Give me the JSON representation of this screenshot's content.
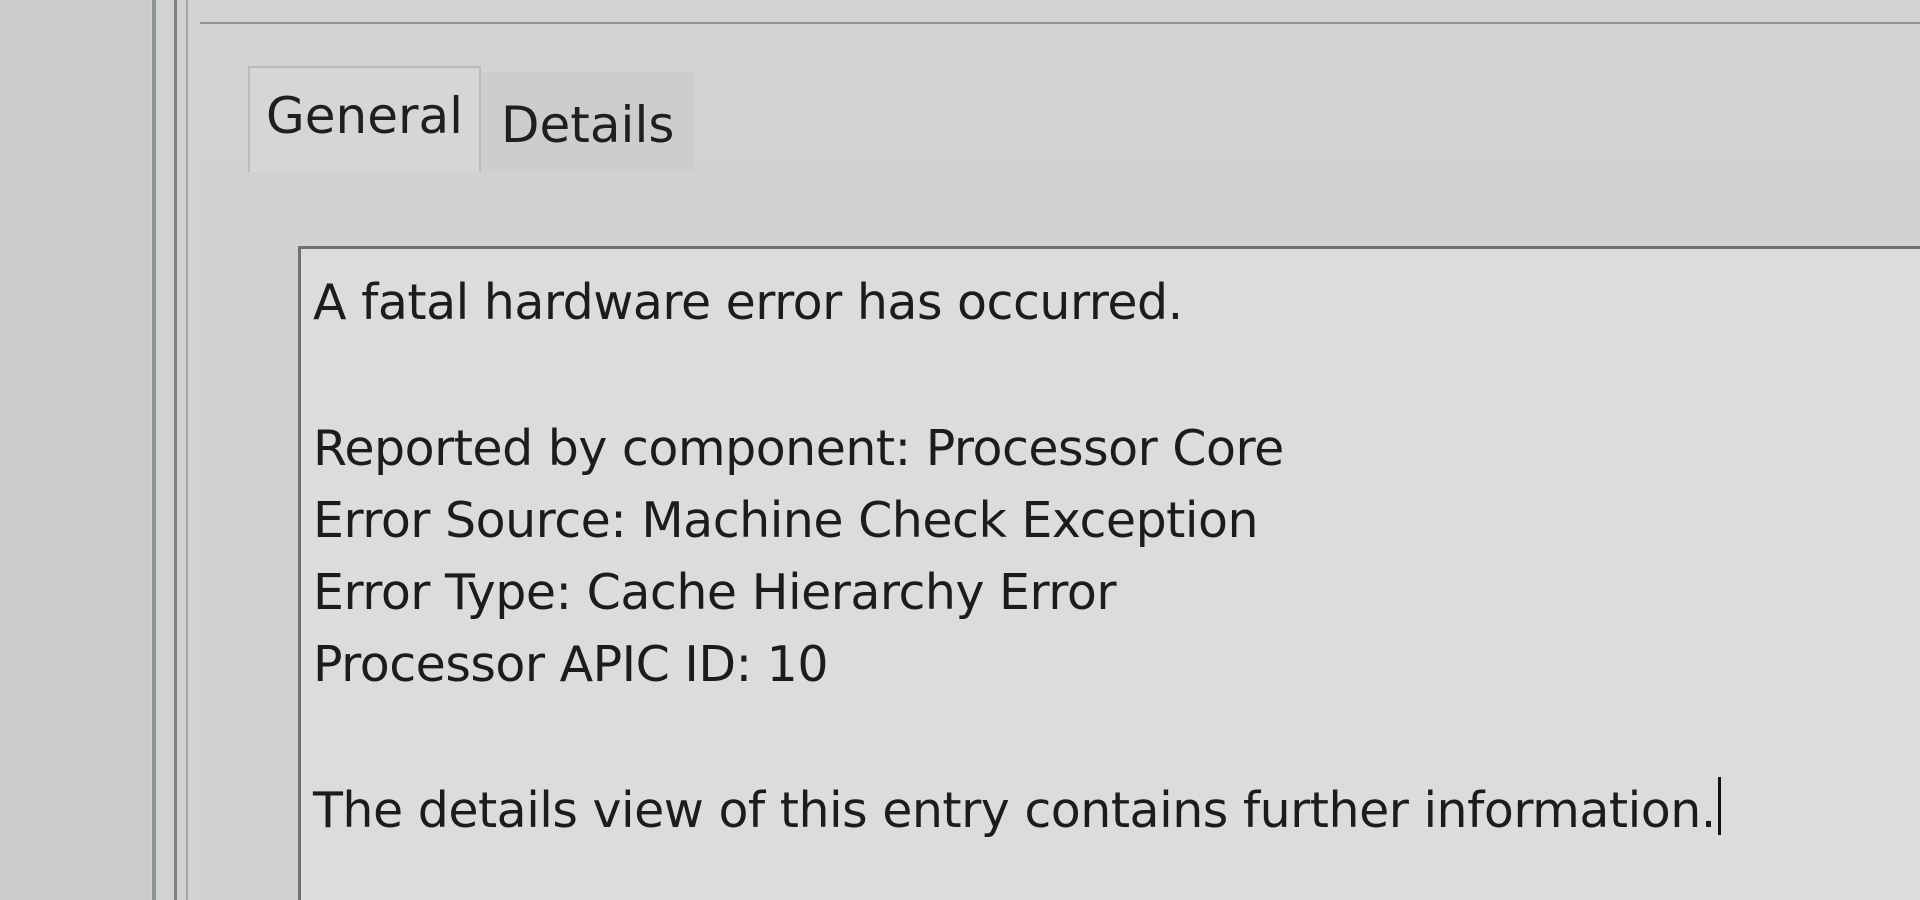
{
  "tabs": [
    {
      "label": "General",
      "selected": true
    },
    {
      "label": "Details",
      "selected": false
    }
  ],
  "general": {
    "message_heading": "A fatal hardware error has occurred.",
    "reported_by": "Reported by component: Processor Core",
    "error_source": "Error Source: Machine Check Exception",
    "error_type": "Error Type: Cache Hierarchy Error",
    "apic_id": "Processor APIC ID: 10",
    "footer_note": "The details view of this entry contains further information."
  }
}
